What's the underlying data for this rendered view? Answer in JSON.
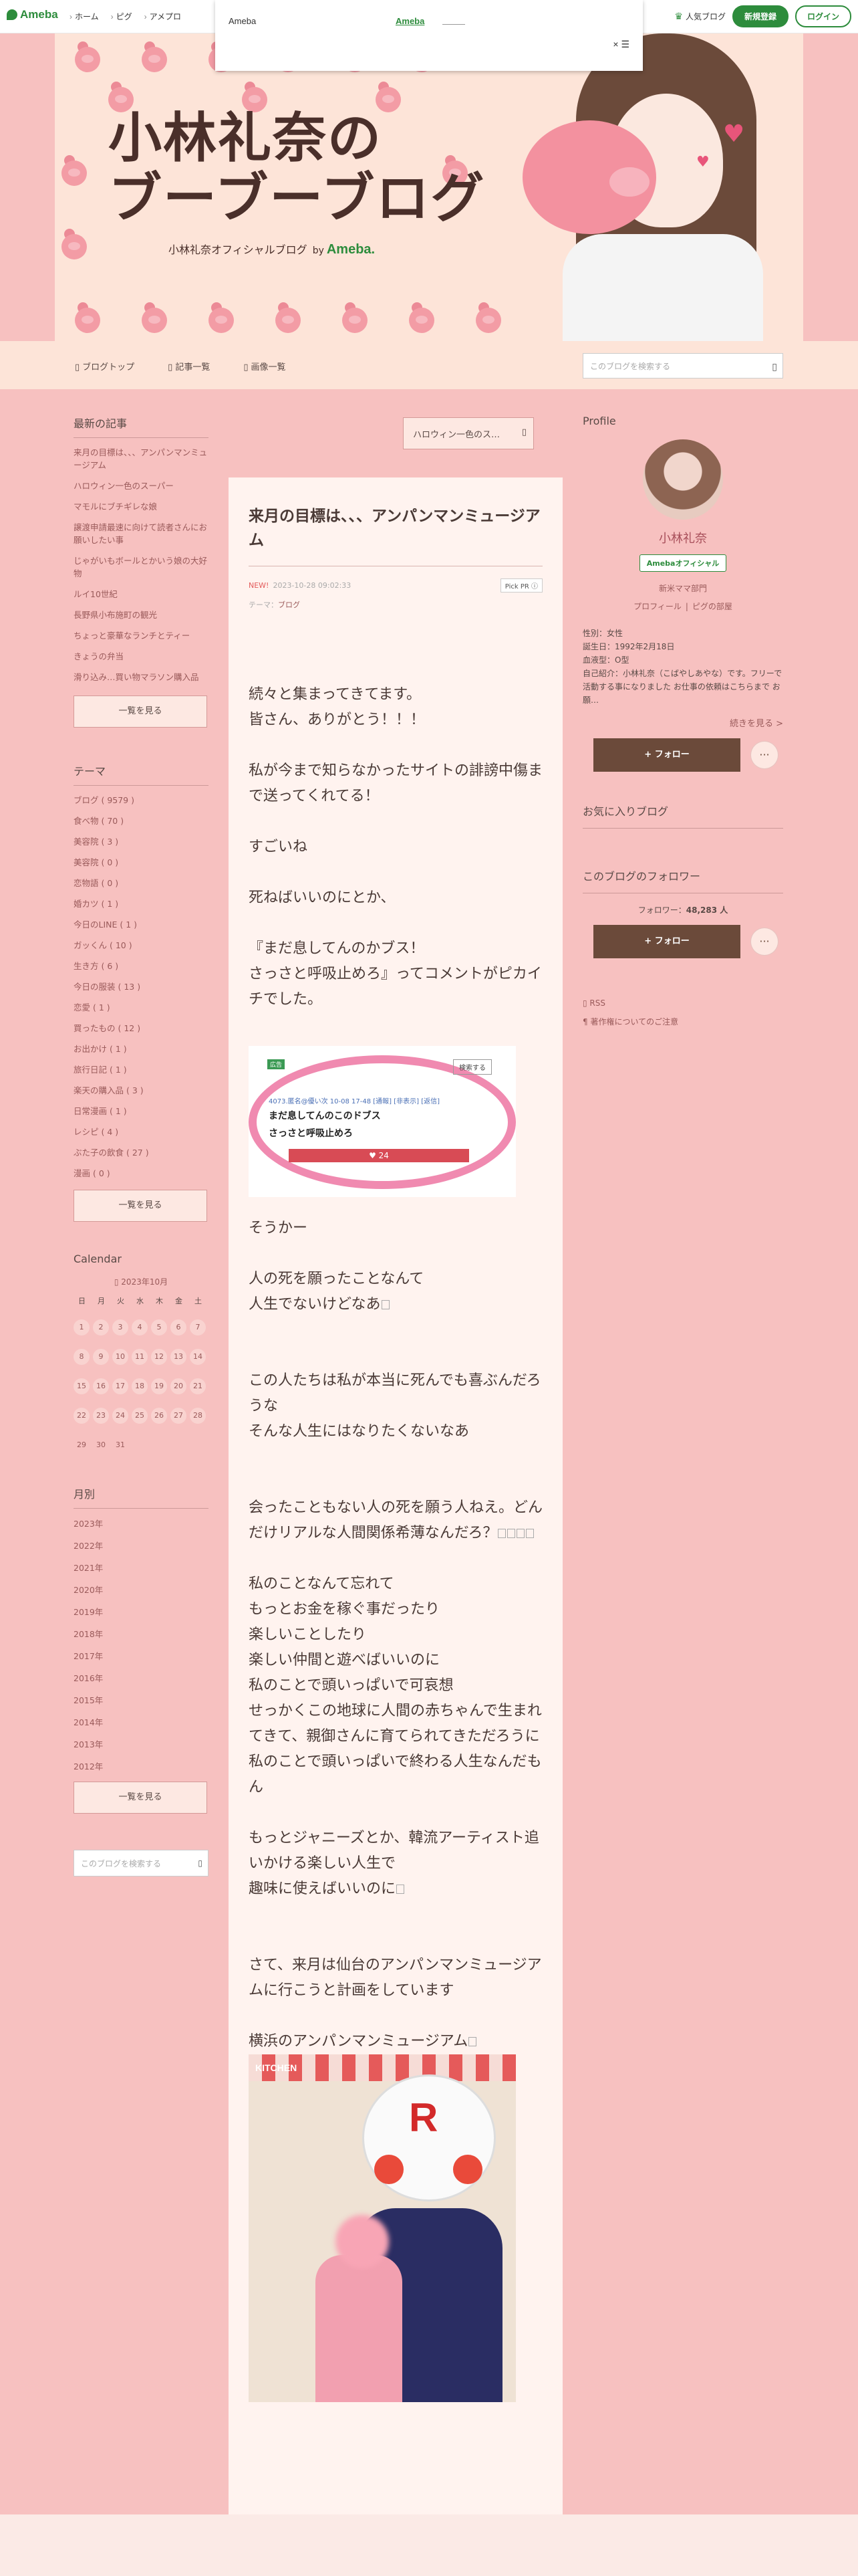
{
  "topbar": {
    "brand": "Ameba",
    "nav": [
      "ホーム",
      "ピグ",
      "アメプロ"
    ],
    "ranking": "人気ブログ",
    "register": "新規登録",
    "login": "ログイン"
  },
  "ad": {
    "label": "Ameba",
    "link": "Ameba",
    "close": "× ☰"
  },
  "header": {
    "title_line1": "小林礼奈の",
    "title_line2": "ブーブーブログ",
    "subtitle": "小林礼奈オフィシャルブログ",
    "by": "by",
    "ameba": "Ameba."
  },
  "blognav": {
    "items": [
      "ブログトップ",
      "記事一覧",
      "画像一覧"
    ],
    "search_placeholder": "このブログを検索する"
  },
  "left": {
    "recent_title": "最新の記事",
    "recent": [
      "来月の目標は、、、アンパンマンミュージアム",
      "ハロウィン一色のスーパー",
      "マモルにブチギレな娘",
      "譲渡申請最速に向けて読者さんにお願いしたい事",
      "じゃがいもボールとかいう娘の大好物",
      "ルイ10世紀",
      "長野県小布施町の観光",
      "ちょっと豪華なランチとティー",
      "きょうの弁当",
      "滑り込み…買い物マラソン購入品"
    ],
    "more1": "一覧を見る",
    "theme_title": "テーマ",
    "themes": [
      "ブログ ( 9579 )",
      "食べ物 ( 70 )",
      "美容院 ( 3 )",
      "美容院 ( 0 )",
      "恋物語 ( 0 )",
      "婚カツ ( 1 )",
      "今日のLINE ( 1 )",
      "ガッくん ( 10 )",
      "生き方 ( 6 )",
      "今日の服装 ( 13 )",
      "恋愛 ( 1 )",
      "買ったもの ( 12 )",
      "お出かけ ( 1 )",
      "旅行日記 ( 1 )",
      "楽天の購入品 ( 3 )",
      "日常漫画 ( 1 )",
      "レシピ ( 4 )",
      "ぶた子の飲食 ( 27 )",
      "漫画 ( 0 )"
    ],
    "more2": "一覧を見る",
    "calendar_title": "Calendar",
    "calendar_month": "2023年10月",
    "weekdays": [
      "日",
      "月",
      "火",
      "水",
      "木",
      "金",
      "土"
    ],
    "days": [
      "1",
      "2",
      "3",
      "4",
      "5",
      "6",
      "7",
      "8",
      "9",
      "10",
      "11",
      "12",
      "13",
      "14",
      "15",
      "16",
      "17",
      "18",
      "19",
      "20",
      "21",
      "22",
      "23",
      "24",
      "25",
      "26",
      "27",
      "28",
      "29",
      "30",
      "31"
    ],
    "monthly_title": "月別",
    "years": [
      "2023年",
      "2022年",
      "2021年",
      "2020年",
      "2019年",
      "2018年",
      "2017年",
      "2016年",
      "2015年",
      "2014年",
      "2013年",
      "2012年"
    ],
    "more3": "一覧を見る",
    "search_placeholder": "このブログを検索する"
  },
  "center": {
    "prev": "ハロウィン一色のス…",
    "title": "来月の目標は、、、アンパンマンミュージアム",
    "new": "NEW!",
    "date": "2023-10-28 09:02:33",
    "pick": "Pick PR ⓘ",
    "theme_label": "テーマ：",
    "theme": "ブログ",
    "p1": "続々と集まってきてます。",
    "p2": "皆さん、ありがとう！！！",
    "p3": "私が今まで知らなかったサイトの誹謗中傷まで送ってくれてる！",
    "p4": "すごいね",
    "p5": "死ねばいいのにとか、",
    "p6": "『まだ息してんのかブス！",
    "p7": "さっさと呼吸止めろ』ってコメントがピカイチでした。",
    "shot_tag": "広告",
    "shot_btn": "検索する",
    "shot_meta": "4073.匿名@優い次 10-08 17-48 [通報] [非表示] [返信]",
    "shot_c1": "まだ息してんのこのドブス",
    "shot_c2": "さっさと呼吸止めろ",
    "shot_like": "♥ 24",
    "p8": "そうかー",
    "p9": "人の死を願ったことなんて",
    "p10": "人生でないけどなあ",
    "p11": "この人たちは私が本当に死んでも喜ぶんだろうな",
    "p12": "そんな人生にはなりたくないなあ",
    "p13": "会ったこともない人の死を願う人ねえ。どんだけリアルな人間関係希薄なんだろ？",
    "p14": "私のことなんて忘れて",
    "p15": "もっとお金を稼ぐ事だったり",
    "p16": "楽しいことしたり",
    "p17": "楽しい仲間と遊べばいいのに",
    "p18": "私のことで頭いっぱいで可哀想",
    "p19": "せっかくこの地球に人間の赤ちゃんで生まれてきて、親御さんに育てられてきただろうに",
    "p20": "私のことで頭いっぱいで終わる人生なんだもん",
    "p21": "もっとジャニーズとか、韓流アーティスト追いかける楽しい人生で",
    "p22": "趣味に使えばいいのに",
    "p23": "さて、来月は仙台のアンパンマンミュージアムに行こうと計画をしています",
    "p24": "横浜のアンパンマンミュージアム",
    "photo_sign": "KITCHEN",
    "photo_letter": "R"
  },
  "right": {
    "profile_title": "Profile",
    "name": "小林礼奈",
    "badge": "Amebaオフィシャル",
    "category": "新米ママ部門",
    "link1": "プロフィール",
    "link2": "ピグの部屋",
    "info": "性別：女性\n誕生日：1992年2月18日\n血液型：O型\n自己紹介：小林礼奈（こばやしあやな）です。フリーで活動する事になりました お仕事の依頼はこちらまで お願…",
    "read_more": "続きを見る >",
    "follow": "+ フォロー",
    "dots": "···",
    "fav_title": "お気に入りブログ",
    "followers_title": "このブログのフォロワー",
    "followers_label": "フォロワー：",
    "followers_count": "48,283 人",
    "rss": "RSS",
    "copyright": "著作権についてのご注意"
  }
}
